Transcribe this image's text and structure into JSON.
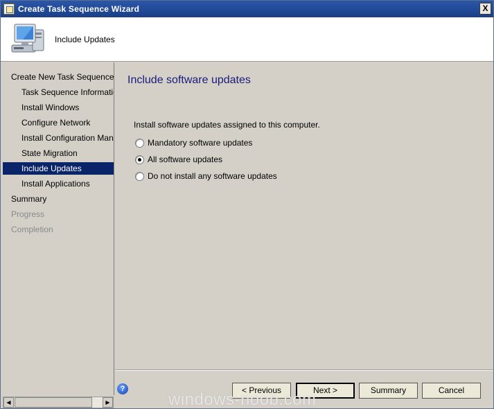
{
  "window": {
    "title": "Create Task Sequence Wizard",
    "close_label": "X"
  },
  "header": {
    "title": "Include Updates",
    "icon": "computer-icon"
  },
  "sidebar": {
    "items": [
      {
        "label": "Create New Task Sequence",
        "level": "top",
        "state": "normal"
      },
      {
        "label": "Task Sequence Information",
        "level": "sub",
        "state": "normal"
      },
      {
        "label": "Install Windows",
        "level": "sub",
        "state": "normal"
      },
      {
        "label": "Configure Network",
        "level": "sub",
        "state": "normal"
      },
      {
        "label": "Install Configuration Manag",
        "level": "sub",
        "state": "normal"
      },
      {
        "label": "State Migration",
        "level": "sub",
        "state": "normal"
      },
      {
        "label": "Include Updates",
        "level": "sub",
        "state": "active"
      },
      {
        "label": "Install Applications",
        "level": "sub",
        "state": "normal"
      },
      {
        "label": "Summary",
        "level": "top",
        "state": "normal"
      },
      {
        "label": "Progress",
        "level": "top",
        "state": "disabled"
      },
      {
        "label": "Completion",
        "level": "top",
        "state": "disabled"
      }
    ]
  },
  "main": {
    "title": "Include software updates",
    "description": "Install software updates assigned to this computer.",
    "options": [
      {
        "label": "Mandatory software updates",
        "checked": false
      },
      {
        "label": "All software updates",
        "checked": true
      },
      {
        "label": "Do not install any software updates",
        "checked": false
      }
    ]
  },
  "footer": {
    "help_label": "?",
    "previous_label": "< Previous",
    "next_label": "Next >",
    "summary_label": "Summary",
    "cancel_label": "Cancel"
  },
  "watermark": "windows-noob.com"
}
